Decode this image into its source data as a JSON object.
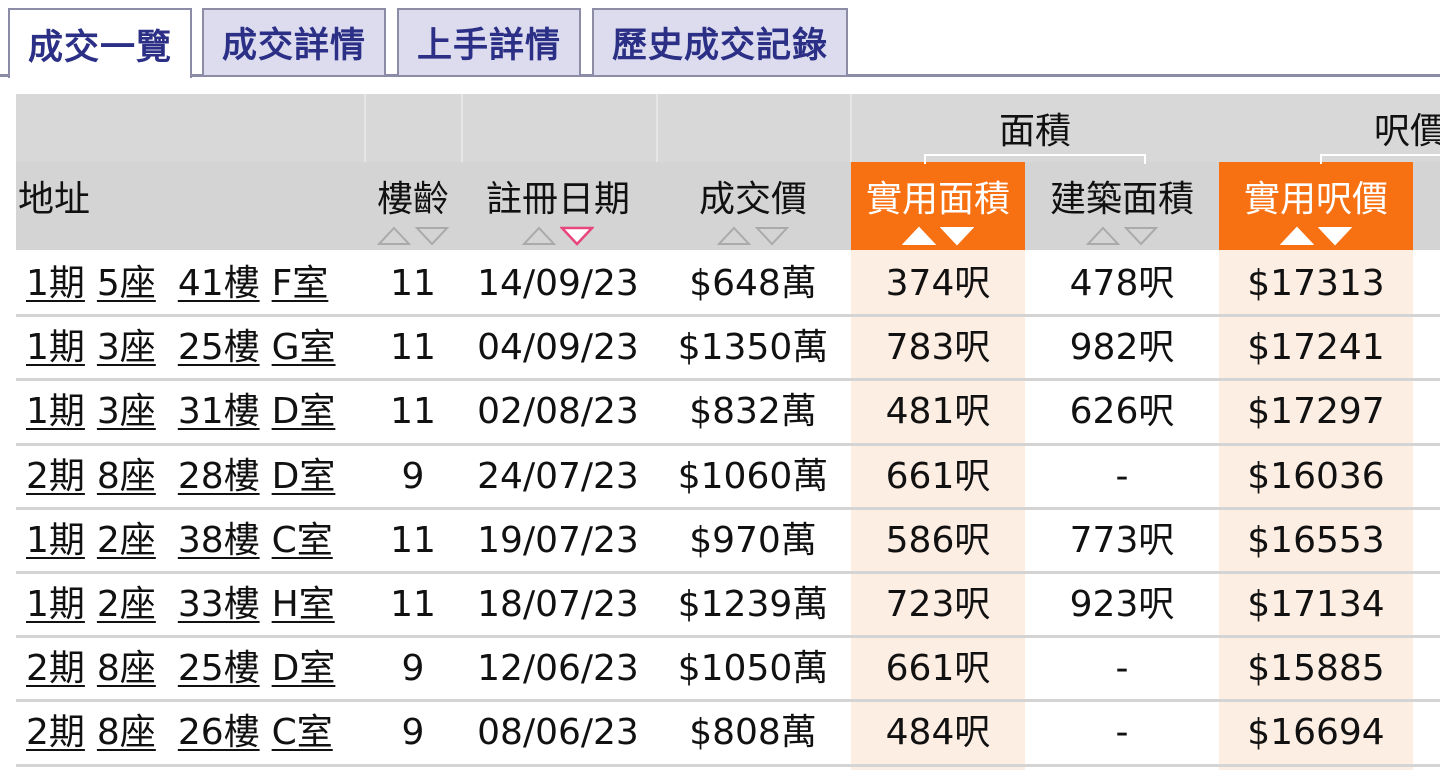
{
  "tabs": [
    {
      "label": "成交一覽",
      "active": true
    },
    {
      "label": "成交詳情",
      "active": false
    },
    {
      "label": "上手詳情",
      "active": false
    },
    {
      "label": "歷史成交記錄",
      "active": false
    }
  ],
  "table": {
    "group_headers": {
      "area": "面積",
      "price_per_ft": "呎價"
    },
    "columns": {
      "address": "地址",
      "age": "樓齡",
      "reg_date": "註冊日期",
      "price": "成交價",
      "saleable_area": "實用面積",
      "gross_area": "建築面積",
      "saleable_price": "實用呎價"
    },
    "sort_active": "reg_date-desc",
    "rows": [
      {
        "phase": "1期",
        "block": "5座",
        "floor": "41樓",
        "unit": "F室",
        "age": "11",
        "date": "14/09/23",
        "price": "$648萬",
        "saleable": "374呎",
        "gross": "478呎",
        "psf": "$17313"
      },
      {
        "phase": "1期",
        "block": "3座",
        "floor": "25樓",
        "unit": "G室",
        "age": "11",
        "date": "04/09/23",
        "price": "$1350萬",
        "saleable": "783呎",
        "gross": "982呎",
        "psf": "$17241"
      },
      {
        "phase": "1期",
        "block": "3座",
        "floor": "31樓",
        "unit": "D室",
        "age": "11",
        "date": "02/08/23",
        "price": "$832萬",
        "saleable": "481呎",
        "gross": "626呎",
        "psf": "$17297"
      },
      {
        "phase": "2期",
        "block": "8座",
        "floor": "28樓",
        "unit": "D室",
        "age": "9",
        "date": "24/07/23",
        "price": "$1060萬",
        "saleable": "661呎",
        "gross": "-",
        "psf": "$16036"
      },
      {
        "phase": "1期",
        "block": "2座",
        "floor": "38樓",
        "unit": "C室",
        "age": "11",
        "date": "19/07/23",
        "price": "$970萬",
        "saleable": "586呎",
        "gross": "773呎",
        "psf": "$16553"
      },
      {
        "phase": "1期",
        "block": "2座",
        "floor": "33樓",
        "unit": "H室",
        "age": "11",
        "date": "18/07/23",
        "price": "$1239萬",
        "saleable": "723呎",
        "gross": "923呎",
        "psf": "$17134"
      },
      {
        "phase": "2期",
        "block": "8座",
        "floor": "25樓",
        "unit": "D室",
        "age": "9",
        "date": "12/06/23",
        "price": "$1050萬",
        "saleable": "661呎",
        "gross": "-",
        "psf": "$15885"
      },
      {
        "phase": "2期",
        "block": "8座",
        "floor": "26樓",
        "unit": "C室",
        "age": "9",
        "date": "08/06/23",
        "price": "$808萬",
        "saleable": "484呎",
        "gross": "-",
        "psf": "$16694"
      }
    ]
  },
  "colors": {
    "tab_text": "#2b2f86",
    "tab_bg": "#dcdcee",
    "header_bg": "#d4d4d4",
    "highlight": "#f77012",
    "highlight_pale": "#fdeee4",
    "sort_active": "#e8467c"
  }
}
